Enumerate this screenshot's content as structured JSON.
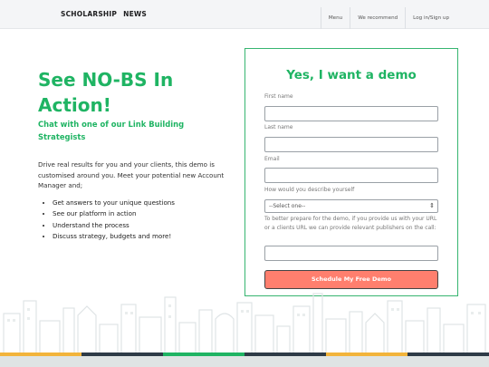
{
  "header": {
    "brand_word1": "SCHOLARSHIP",
    "brand_word2": "NEWS",
    "nav": [
      "Menu",
      "We recommend",
      "Log in/Sign up"
    ]
  },
  "hero": {
    "title": "See NO-BS In Action!",
    "subtitle": "Chat with one of our Link Building Strategists",
    "description": "Drive real results for you and your clients, this demo is customised around you. Meet your potential new Account Manager and;",
    "bullets": [
      "Get answers to your unique questions",
      "See our platform in action",
      "Understand the process",
      "Discuss strategy, budgets and more!"
    ]
  },
  "form": {
    "title": "Yes, I want a demo",
    "first_name_label": "First name",
    "first_name_value": "",
    "last_name_label": "Last name",
    "last_name_value": "",
    "email_label": "Email",
    "email_value": "",
    "describe_label": "How would you describe yourself",
    "describe_selected": "--Select one--",
    "note": "To better prepare for the demo, if you provide us with your URL or a clients URL we can provide relevant publishers on the call:",
    "url_value": "",
    "submit_label": "Schedule My Free Demo"
  },
  "colors": {
    "accent_green": "#1fb463",
    "card_border": "#36b570",
    "button_coral": "#ff7f6e",
    "header_bg": "#f4f5f7"
  },
  "icons": {
    "select_chevron": "chevron-updown-icon",
    "skyline": "city-skyline-illustration"
  }
}
